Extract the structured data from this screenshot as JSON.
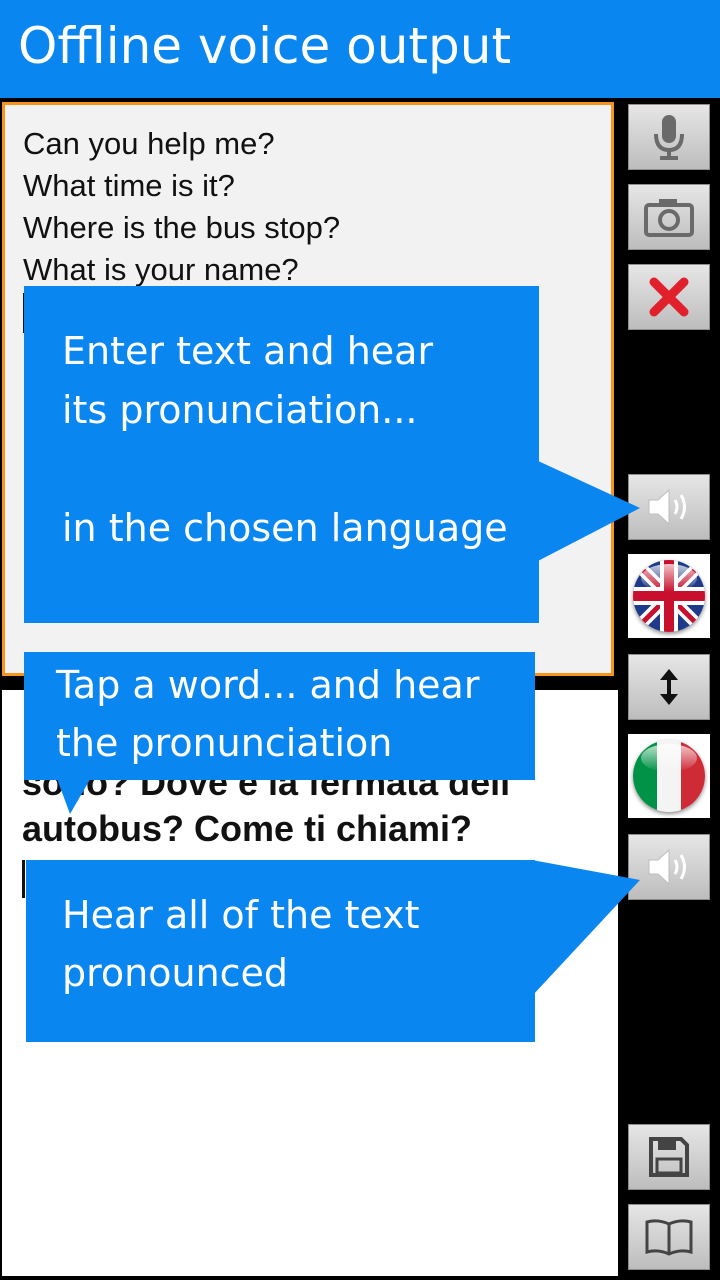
{
  "app": {
    "title": "Offline voice output"
  },
  "input": {
    "text": "Can you help me?\nWhat time is it?\nWhere is the bus stop?\nWhat is your name?"
  },
  "output": {
    "text": "sono? Dove è la fermata dell' autobus? Come ti chiami?"
  },
  "tooltips": {
    "enter_text": "Enter text and hear\nits pronunciation...\n\nin the chosen language",
    "tap_word": "Tap a word... and hear\nthe pronunciation",
    "hear_all": "Hear all of the text\npronounced"
  },
  "side_buttons": {
    "microphone": "microphone-icon",
    "camera": "camera-icon",
    "clear": "close-icon",
    "speak_input": "speaker-icon",
    "source_language": "uk-flag-icon",
    "swap": "swap-vertical-icon",
    "target_language": "italy-flag-icon",
    "speak_output": "speaker-icon",
    "save": "save-icon",
    "dictionary": "book-icon"
  },
  "colors": {
    "accent": "#0a86f0",
    "input_border": "#f7941d",
    "clear_red": "#e0202a"
  }
}
